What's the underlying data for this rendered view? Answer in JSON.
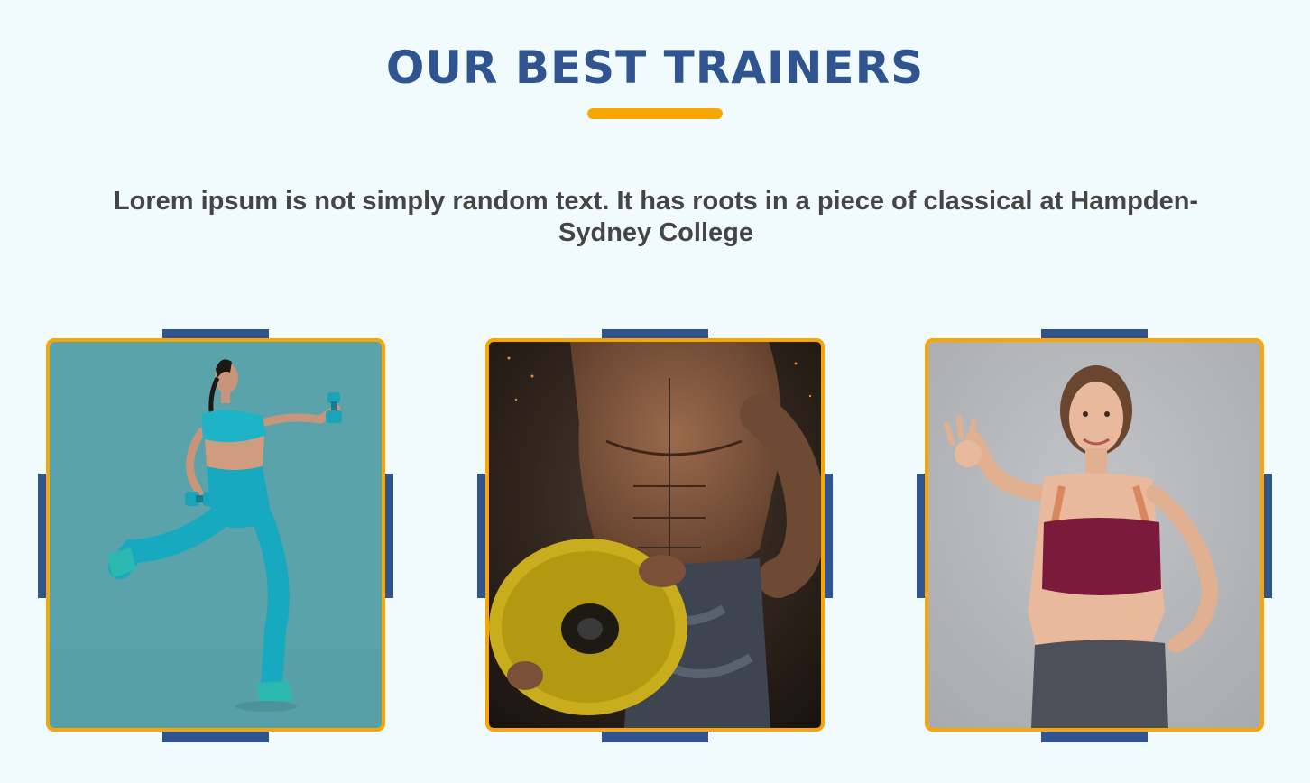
{
  "section": {
    "title": "OUR BEST TRAINERS",
    "description": "Lorem ipsum is not simply random text. It has roots in a piece of classical at Hampden-Sydney College"
  },
  "colors": {
    "background": "#f1fafd",
    "title": "#2f5490",
    "accent": "#f9a602",
    "decor": "#2f5490",
    "text": "#454545"
  },
  "trainers": [
    {
      "photo": "woman-running-with-dumbbells-photo"
    },
    {
      "photo": "muscular-man-holding-weight-plate-photo"
    },
    {
      "photo": "smiling-woman-ok-gesture-photo"
    }
  ]
}
